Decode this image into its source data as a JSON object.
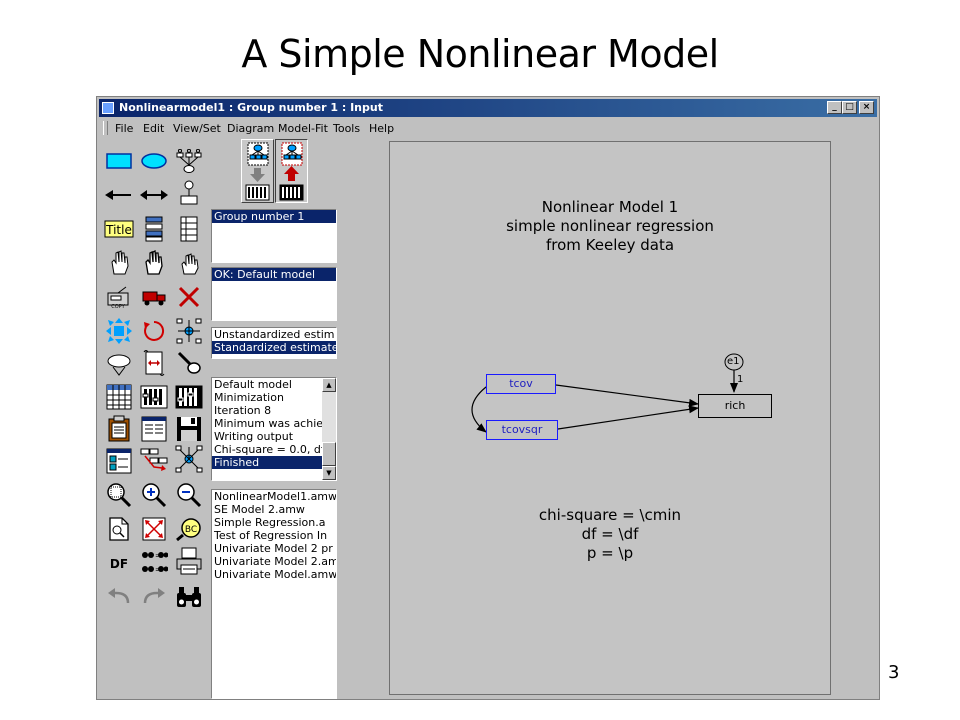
{
  "slide": {
    "title": "A Simple Nonlinear Model",
    "number": "3"
  },
  "window": {
    "title": "Nonlinearmodel1 : Group number 1 : Input",
    "buttons": {
      "minimize": "_",
      "restore": "□",
      "close": "×"
    }
  },
  "menu": [
    "File",
    "Edit",
    "View/Set",
    "Diagram",
    "Model-Fit",
    "Tools",
    "Help"
  ],
  "panels": {
    "groups": [
      "Group number 1"
    ],
    "models": [
      "OK: Default model"
    ],
    "estimates": [
      "Unstandardized estim",
      "Standardized estimate"
    ],
    "messages": [
      "Default model",
      "Minimization",
      "Iteration 8",
      "Minimum was achie",
      "Writing output",
      "Chi-square = 0.0, df",
      "Finished"
    ],
    "files": [
      "NonlinearModel1.amw",
      "SE Model 2.amw",
      "Simple Regression.a",
      "Test of Regression In",
      "Univariate Model 2 pr",
      "Univariate Model 2.am",
      "Univariate Model.amw"
    ]
  },
  "toolbox": {
    "title_tool_label": "Title",
    "df_tool_label": "DF"
  },
  "diagram": {
    "caption_lines": [
      "Nonlinear Model 1",
      "simple nonlinear regression",
      "from Keeley data"
    ],
    "variables": {
      "tcov": "tcov",
      "tcovsqr": "tcovsqr",
      "rich": "rich",
      "error": "e1",
      "error_weight": "1"
    },
    "fit_lines": [
      "chi-square = \\cmin",
      "df = \\df",
      "p = \\p"
    ]
  },
  "colors": {
    "titlebar": "#0a246a",
    "selection": "#0a246a",
    "variable_blue": "#1a1aff",
    "window_gray": "#c0c0c0"
  }
}
